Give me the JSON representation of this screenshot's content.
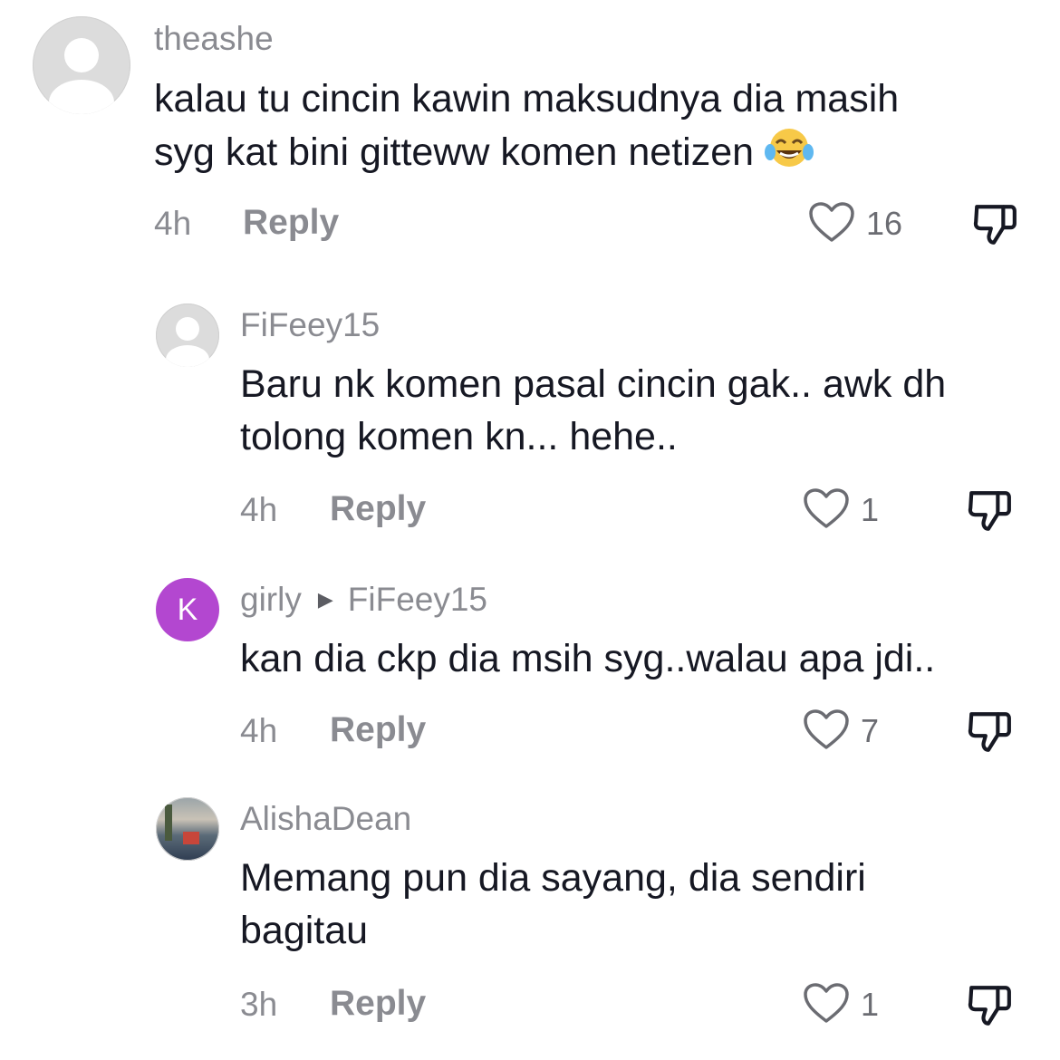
{
  "comments": [
    {
      "username": "theashe",
      "text": "kalau tu cincin kawin maksudnya dia masih",
      "text_line2": "syg kat bini gitteww komen netizen",
      "emoji": "face-with-tears-of-joy",
      "time": "4h",
      "reply_label": "Reply",
      "likes": "16"
    },
    {
      "username": "FiFeey15",
      "text": "Baru nk komen pasal cincin gak.. awk dh",
      "text_line2": "tolong komen kn... hehe..",
      "time": "4h",
      "reply_label": "Reply",
      "likes": "1"
    },
    {
      "username": "girly",
      "reply_to": "FiFeey15",
      "avatar_letter": "K",
      "avatar_color": "#b347d0",
      "text": "kan dia ckp dia msih syg..walau apa jdi..",
      "time": "4h",
      "reply_label": "Reply",
      "likes": "7"
    },
    {
      "username": "AlishaDean",
      "text": "Memang pun dia sayang, dia sendiri",
      "text_line2": "bagitau",
      "time": "3h",
      "reply_label": "Reply",
      "likes": "1"
    }
  ],
  "icons": {
    "like": "heart-outline-icon",
    "dislike": "thumbs-down-icon",
    "reply_arrow": "triangle-right-icon",
    "placeholder_avatar": "default-avatar-icon"
  },
  "colors": {
    "text": "#161823",
    "secondary": "#8a8b91",
    "avatar_placeholder": "#dcdcdc"
  }
}
